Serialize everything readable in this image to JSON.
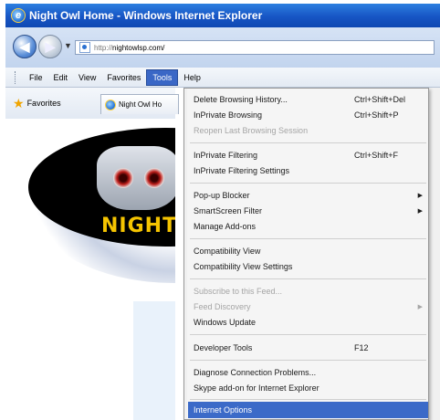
{
  "window": {
    "title": "Night Owl Home - Windows Internet Explorer"
  },
  "address": {
    "url_protocol": "http://",
    "url_host": "nightowlsp.com/"
  },
  "menubar": {
    "items": [
      "File",
      "Edit",
      "View",
      "Favorites",
      "Tools",
      "Help"
    ],
    "active": "Tools"
  },
  "favorites": {
    "label": "Favorites"
  },
  "tab": {
    "title": "Night Owl Ho"
  },
  "logo": {
    "text": "NIGHT O"
  },
  "tools_menu": {
    "items": [
      {
        "label": "Delete Browsing History...",
        "shortcut": "Ctrl+Shift+Del"
      },
      {
        "label": "InPrivate Browsing",
        "shortcut": "Ctrl+Shift+P"
      },
      {
        "label": "Reopen Last Browsing Session",
        "shortcut": "",
        "disabled": true
      },
      {
        "label": "InPrivate Filtering",
        "shortcut": "Ctrl+Shift+F"
      },
      {
        "label": "InPrivate Filtering Settings",
        "shortcut": ""
      },
      {
        "label": "Pop-up Blocker",
        "submenu": true
      },
      {
        "label": "SmartScreen Filter",
        "submenu": true
      },
      {
        "label": "Manage Add-ons",
        "shortcut": ""
      },
      {
        "label": "Compatibility View",
        "shortcut": ""
      },
      {
        "label": "Compatibility View Settings",
        "shortcut": ""
      },
      {
        "label": "Subscribe to this Feed...",
        "disabled": true
      },
      {
        "label": "Feed Discovery",
        "disabled": true,
        "submenu": true
      },
      {
        "label": "Windows Update",
        "shortcut": ""
      },
      {
        "label": "Developer Tools",
        "shortcut": "F12"
      },
      {
        "label": "Diagnose Connection Problems...",
        "shortcut": ""
      },
      {
        "label": "Skype add-on for Internet Explorer",
        "shortcut": ""
      },
      {
        "label": "Internet Options",
        "shortcut": "",
        "highlighted": true
      }
    ]
  },
  "colors": {
    "titlebar": "#1755c4",
    "highlight": "#3b6ac8",
    "logo_text": "#f5c400"
  }
}
